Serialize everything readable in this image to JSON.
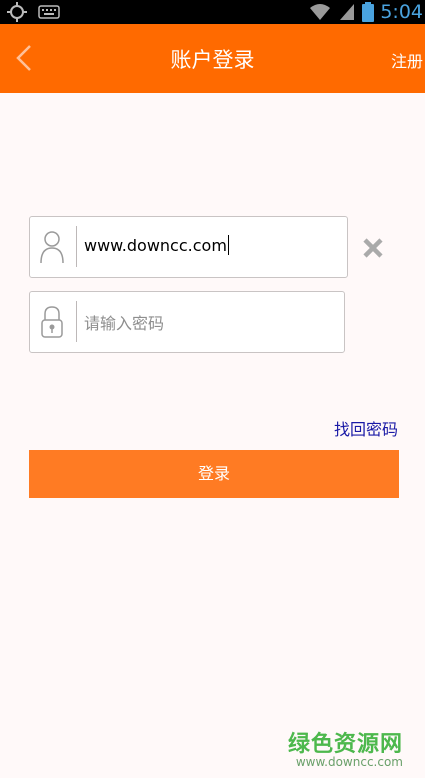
{
  "status_bar": {
    "time": "5:04",
    "icons": [
      "gps-icon",
      "keyboard-icon",
      "wifi-icon",
      "signal-icon",
      "battery-icon"
    ]
  },
  "header": {
    "title": "账户登录",
    "register_label": "注册",
    "back_icon": "chevron-left-icon"
  },
  "form": {
    "username_value": "www.downcc.com",
    "username_icon": "user-icon",
    "password_placeholder": "请输入密码",
    "password_icon": "lock-icon",
    "clear_icon": "close-icon"
  },
  "forgot_password_label": "找回密码",
  "login_button_label": "登录",
  "watermark": {
    "brand": "绿色资源网",
    "url": "www.downcc.com"
  },
  "colors": {
    "header_bg": "#ff6a00",
    "button_bg": "#ff7b23",
    "link": "#1a1aa6",
    "page_bg": "#fff9f9"
  }
}
